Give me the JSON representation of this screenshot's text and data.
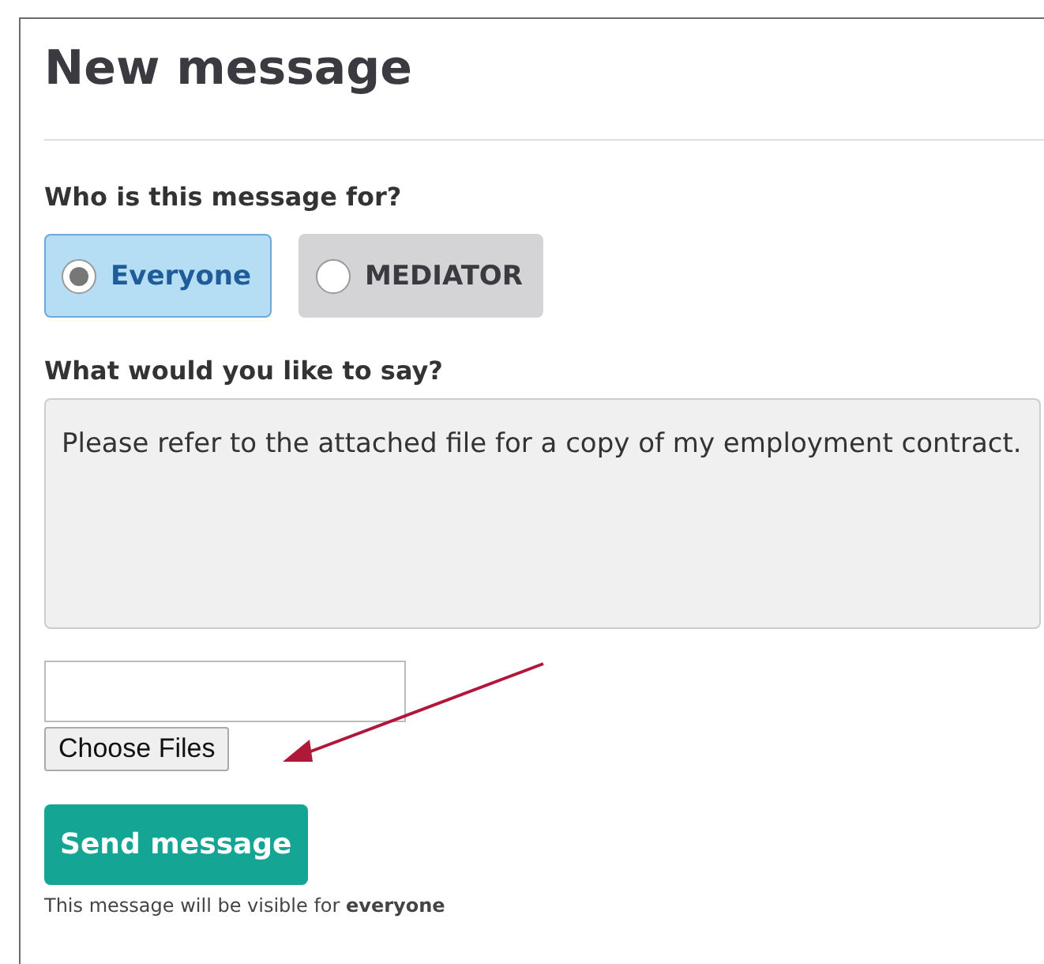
{
  "title": "New message",
  "recipient": {
    "label": "Who is this message for?",
    "options": [
      {
        "label": "Everyone",
        "selected": true
      },
      {
        "label": "MEDIATOR",
        "selected": false
      }
    ]
  },
  "message": {
    "label": "What would you like to say?",
    "value": "Please refer to the attached file for a copy of my employment contract."
  },
  "attachment": {
    "button": "Choose Files"
  },
  "send_button": "Send message",
  "note": "This message will be visible for **everyone**"
}
